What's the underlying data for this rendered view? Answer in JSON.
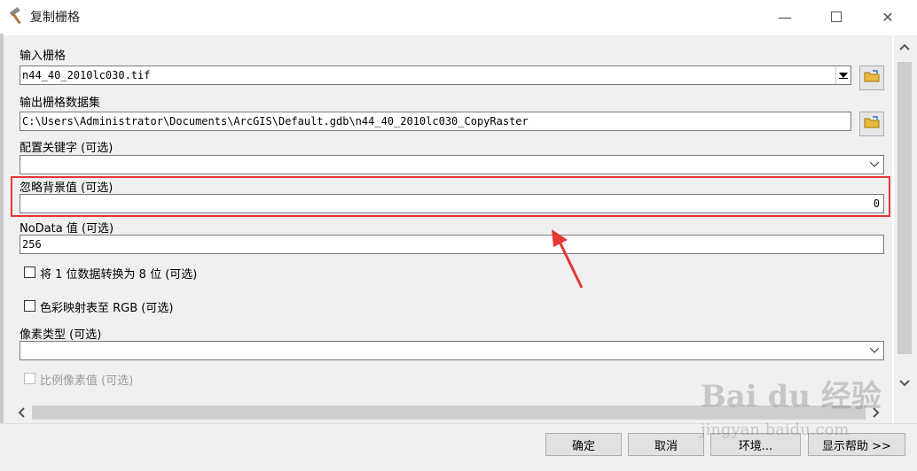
{
  "window": {
    "title": "复制栅格",
    "controls": [
      "minimize-icon",
      "maximize-icon",
      "close-icon"
    ]
  },
  "params": {
    "input_raster": {
      "label": "输入栅格",
      "value": "n44_40_2010lc030.tif"
    },
    "output_raster": {
      "label": "输出栅格数据集",
      "value": "C:\\Users\\Administrator\\Documents\\ArcGIS\\Default.gdb\\n44_40_2010lc030_CopyRaster"
    },
    "config_keyword": {
      "label": "配置关键字 (可选)",
      "value": ""
    },
    "ignore_background": {
      "label": "忽略背景值 (可选)",
      "value": "0"
    },
    "nodata": {
      "label": "NoData 值 (可选)",
      "value": "256"
    },
    "one_bit_to_eight": {
      "label": "将 1 位数据转换为 8 位 (可选)",
      "checked": false
    },
    "colormap_to_rgb": {
      "label": "色彩映射表至 RGB (可选)",
      "checked": false
    },
    "pixel_type": {
      "label": "像素类型 (可选)",
      "value": ""
    },
    "scale_pixel": {
      "label": "比例像素值 (可选)",
      "checked": false,
      "disabled": true
    }
  },
  "buttons": {
    "ok": "确定",
    "cancel": "取消",
    "environments": "环境...",
    "show_help": "显示帮助 >>"
  },
  "watermark": {
    "brand": "Bai du 经验",
    "url": "jingyan.baidu.com"
  },
  "colors": {
    "annotation": "#e53935",
    "dialog_bg": "#f0f0f0"
  }
}
